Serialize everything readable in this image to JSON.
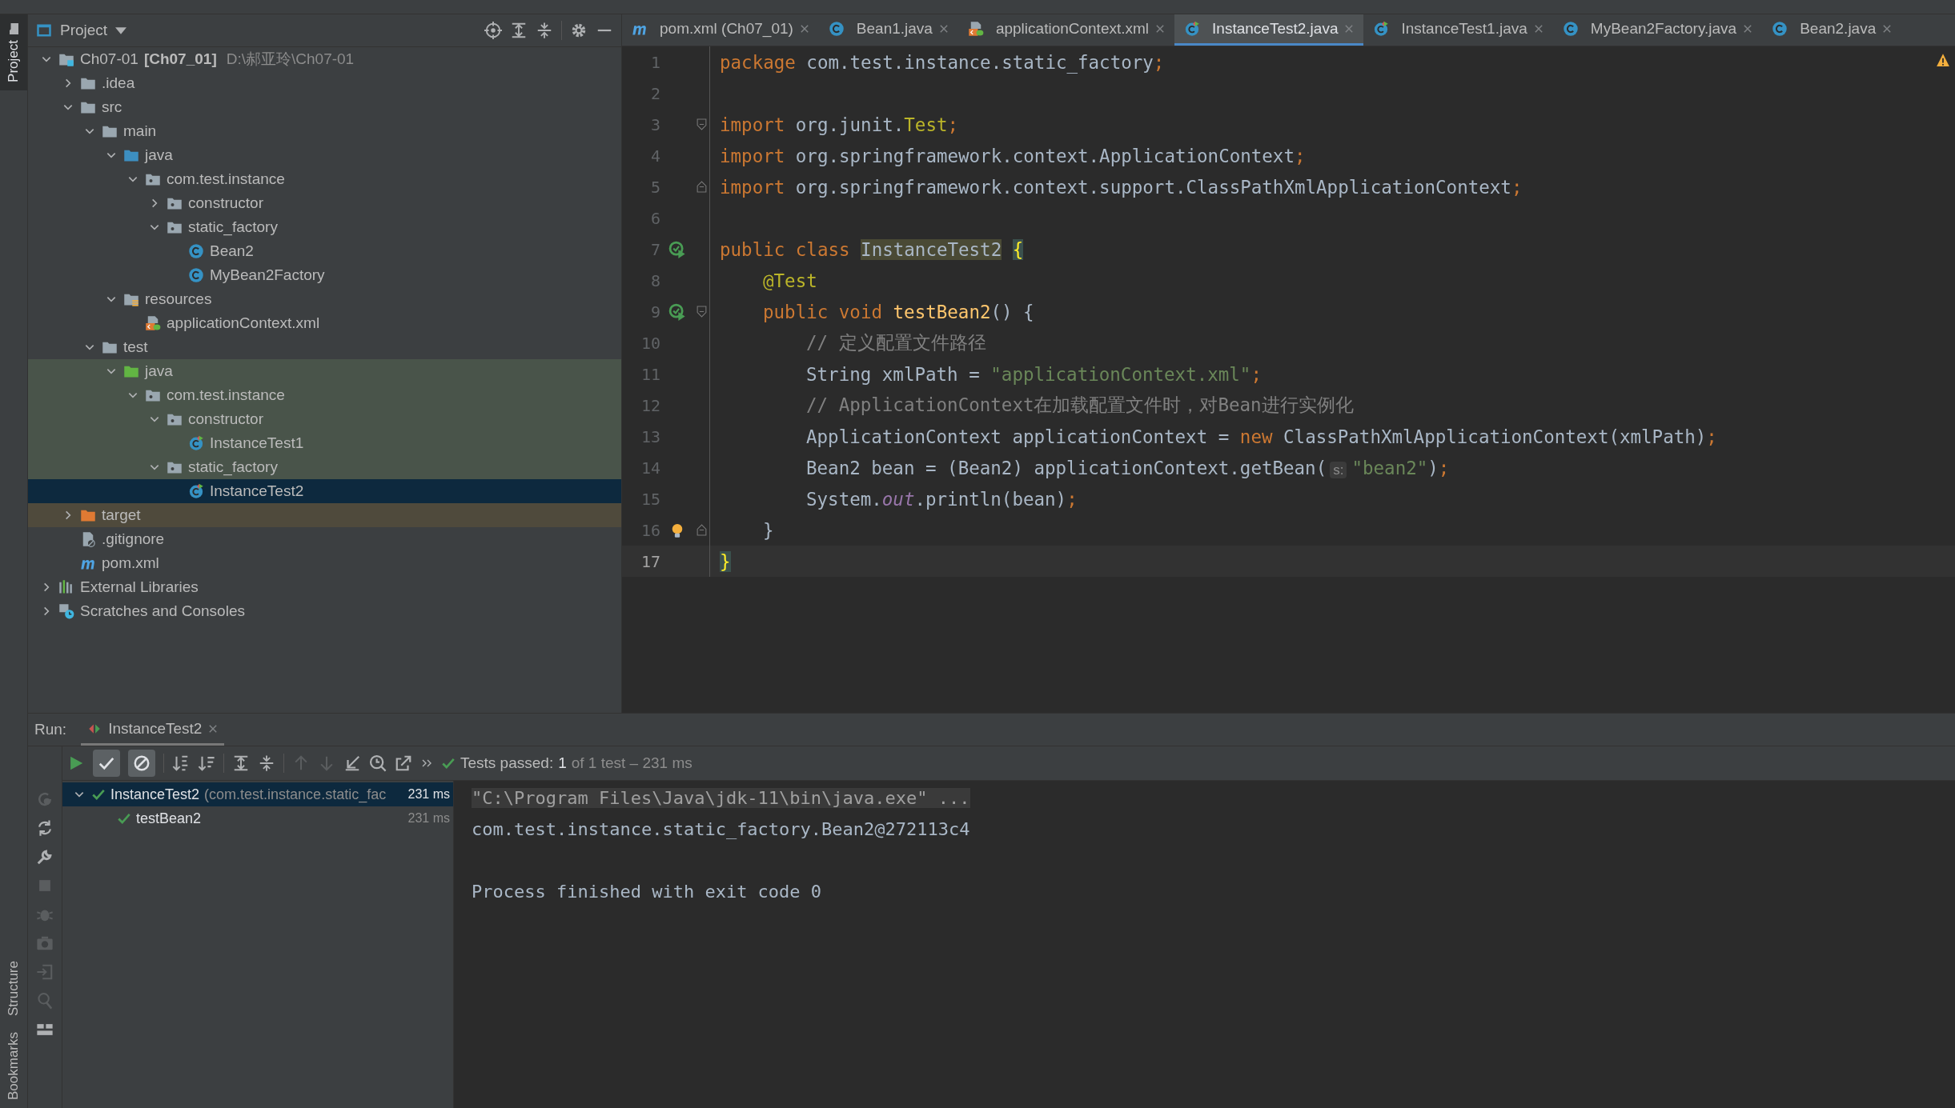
{
  "side_tabs_top": [
    {
      "label": "Project",
      "selected": true
    }
  ],
  "side_tabs_bottom": [
    {
      "label": "Structure",
      "selected": false
    },
    {
      "label": "Bookmarks",
      "selected": false
    }
  ],
  "project_panel": {
    "title": "Project",
    "tree": [
      {
        "label": "Ch07-01",
        "module": "[Ch07_01]",
        "path": "D:\\郝亚玲\\Ch07-01",
        "kind": "module",
        "expanded": true,
        "selected": false,
        "children": [
          {
            "label": ".idea",
            "kind": "folder",
            "expanded": false,
            "selected": false
          },
          {
            "label": "src",
            "kind": "folder",
            "expanded": true,
            "selected": false,
            "children": [
              {
                "label": "main",
                "kind": "folder",
                "expanded": true,
                "selected": false,
                "children": [
                  {
                    "label": "java",
                    "kind": "sources",
                    "expanded": true,
                    "selected": false,
                    "children": [
                      {
                        "label": "com.test.instance",
                        "kind": "package",
                        "expanded": true,
                        "selected": false,
                        "children": [
                          {
                            "label": "constructor",
                            "kind": "package",
                            "expanded": false,
                            "selected": false
                          },
                          {
                            "label": "static_factory",
                            "kind": "package",
                            "expanded": true,
                            "selected": false,
                            "children": [
                              {
                                "label": "Bean2",
                                "kind": "class",
                                "selected": false
                              },
                              {
                                "label": "MyBean2Factory",
                                "kind": "class",
                                "selected": false
                              }
                            ]
                          }
                        ]
                      }
                    ]
                  },
                  {
                    "label": "resources",
                    "kind": "resources",
                    "expanded": true,
                    "selected": false,
                    "children": [
                      {
                        "label": "applicationContext.xml",
                        "kind": "xml",
                        "selected": false
                      }
                    ]
                  }
                ]
              },
              {
                "label": "test",
                "kind": "folder",
                "expanded": true,
                "selected": false,
                "children": [
                  {
                    "label": "java",
                    "kind": "tests",
                    "expanded": true,
                    "selected": false,
                    "test_root": true,
                    "children": [
                      {
                        "label": "com.test.instance",
                        "kind": "package",
                        "expanded": true,
                        "selected": false,
                        "test_root": true,
                        "children": [
                          {
                            "label": "constructor",
                            "kind": "package",
                            "expanded": true,
                            "selected": false,
                            "test_root": true,
                            "children": [
                              {
                                "label": "InstanceTest1",
                                "kind": "test",
                                "selected": false,
                                "test_root": true
                              }
                            ]
                          },
                          {
                            "label": "static_factory",
                            "kind": "package",
                            "expanded": true,
                            "selected": false,
                            "test_root": true,
                            "children": [
                              {
                                "label": "InstanceTest2",
                                "kind": "test",
                                "selected": true
                              }
                            ]
                          }
                        ]
                      }
                    ]
                  }
                ]
              }
            ]
          },
          {
            "label": "target",
            "kind": "excluded",
            "expanded": false,
            "selected": false,
            "excluded": true
          },
          {
            "label": ".gitignore",
            "kind": "ignore",
            "selected": false
          },
          {
            "label": "pom.xml",
            "kind": "maven",
            "selected": false
          }
        ]
      },
      {
        "label": "External Libraries",
        "kind": "libraries",
        "expanded": false,
        "selected": false
      },
      {
        "label": "Scratches and Consoles",
        "kind": "scratches",
        "expanded": false,
        "selected": false
      }
    ]
  },
  "editor_tabs": [
    {
      "label": "pom.xml (Ch07_01)",
      "kind": "maven",
      "selected": false
    },
    {
      "label": "Bean1.java",
      "kind": "class",
      "selected": false
    },
    {
      "label": "applicationContext.xml",
      "kind": "xml",
      "selected": false
    },
    {
      "label": "InstanceTest2.java",
      "kind": "test",
      "selected": true
    },
    {
      "label": "InstanceTest1.java",
      "kind": "test",
      "selected": false
    },
    {
      "label": "MyBean2Factory.java",
      "kind": "class",
      "selected": false
    },
    {
      "label": "Bean2.java",
      "kind": "class",
      "selected": false
    }
  ],
  "code": [
    {
      "number": "1",
      "tokens": [
        {
          "kind": "keyword",
          "text": "package"
        },
        {
          "kind": "plain",
          "text": " com.test.instance.static_factory"
        },
        {
          "kind": "keyword",
          "text": ";"
        }
      ]
    },
    {
      "number": "2"
    },
    {
      "number": "3",
      "fold_start": true,
      "tokens": [
        {
          "kind": "keyword",
          "text": "import"
        },
        {
          "kind": "plain",
          "text": " org.junit."
        },
        {
          "kind": "annotation",
          "text": "Test"
        },
        {
          "kind": "keyword",
          "text": ";"
        }
      ]
    },
    {
      "number": "4",
      "tokens": [
        {
          "kind": "keyword",
          "text": "import"
        },
        {
          "kind": "plain",
          "text": " org.springframework.context.ApplicationContext"
        },
        {
          "kind": "keyword",
          "text": ";"
        }
      ]
    },
    {
      "number": "5",
      "fold_end": true,
      "tokens": [
        {
          "kind": "keyword",
          "text": "import"
        },
        {
          "kind": "plain",
          "text": " org.springframework.context.support.ClassPathXmlApplicationContext"
        },
        {
          "kind": "keyword",
          "text": ";"
        }
      ]
    },
    {
      "number": "6"
    },
    {
      "number": "7",
      "runnable": true,
      "tokens": [
        {
          "kind": "keyword",
          "text": "public class "
        },
        {
          "kind": "usage",
          "text": "InstanceTest2"
        },
        {
          "kind": "brace",
          "text": "{"
        }
      ],
      "children": [
        {
          "number": "8",
          "tokens": [
            {
              "kind": "annotation",
              "text": "@Test"
            }
          ]
        },
        {
          "number": "9",
          "runnable": true,
          "fold_start": true,
          "tokens": [
            {
              "kind": "keyword",
              "text": "public void "
            },
            {
              "kind": "method",
              "text": "testBean2"
            },
            {
              "kind": "plain",
              "text": "() {"
            }
          ],
          "children": [
            {
              "number": "10",
              "tokens": [
                {
                  "kind": "comment",
                  "text": "// 定义配置文件路径"
                }
              ]
            },
            {
              "number": "11",
              "tokens": [
                {
                  "kind": "plain",
                  "text": "String xmlPath = "
                },
                {
                  "kind": "string",
                  "text": "\"applicationContext.xml\""
                },
                {
                  "kind": "keyword",
                  "text": ";"
                }
              ]
            },
            {
              "number": "12",
              "tokens": [
                {
                  "kind": "comment",
                  "text": "// ApplicationContext在加载配置文件时，对Bean进行实例化"
                }
              ]
            },
            {
              "number": "13",
              "tokens": [
                {
                  "kind": "plain",
                  "text": "ApplicationContext applicationContext = "
                },
                {
                  "kind": "keyword",
                  "text": "new"
                },
                {
                  "kind": "plain",
                  "text": " ClassPathXmlApplicationContext(xmlPath)"
                },
                {
                  "kind": "keyword",
                  "text": ";"
                }
              ]
            },
            {
              "number": "14",
              "tokens": [
                {
                  "kind": "plain",
                  "text": "Bean2 bean = (Bean2) applicationContext.getBean("
                },
                {
                  "kind": "hint",
                  "text": "s:"
                },
                {
                  "kind": "string",
                  "text": "\"bean2\""
                },
                {
                  "kind": "plain",
                  "text": ")"
                },
                {
                  "kind": "keyword",
                  "text": ";"
                }
              ]
            },
            {
              "number": "15",
              "tokens": [
                {
                  "kind": "plain",
                  "text": "System."
                },
                {
                  "kind": "field",
                  "text": "out"
                },
                {
                  "kind": "plain",
                  "text": ".println(bean)"
                },
                {
                  "kind": "keyword",
                  "text": ";"
                }
              ]
            }
          ]
        },
        {
          "number": "16",
          "bulb": true,
          "fold_end": true,
          "tokens": [
            {
              "kind": "plain",
              "text": "}"
            }
          ]
        }
      ]
    },
    {
      "number": "17",
      "current": true,
      "tokens": [
        {
          "kind": "brace",
          "text": "}"
        }
      ]
    }
  ],
  "run_panel": {
    "label": "Run:",
    "tab": "InstanceTest2",
    "show_passed": true,
    "show_ignored": true,
    "status": {
      "label": "Tests passed:",
      "count": "1",
      "detail": "of 1 test – 231 ms"
    },
    "tests": [
      {
        "name": "InstanceTest2",
        "detail": "(com.test.instance.static_fac",
        "time": "231 ms",
        "expanded": true,
        "selected": true,
        "passed": true,
        "children": [
          {
            "name": "testBean2",
            "time": "231 ms",
            "selected": false,
            "passed": true
          }
        ]
      }
    ],
    "console": [
      {
        "kind": "command",
        "text": "\"C:\\Program Files\\Java\\jdk-11\\bin\\java.exe\" ..."
      },
      {
        "kind": "output",
        "text": "com.test.instance.static_factory.Bean2@272113c4"
      },
      {
        "kind": "exit",
        "text": "Process finished with exit code 0"
      }
    ]
  }
}
